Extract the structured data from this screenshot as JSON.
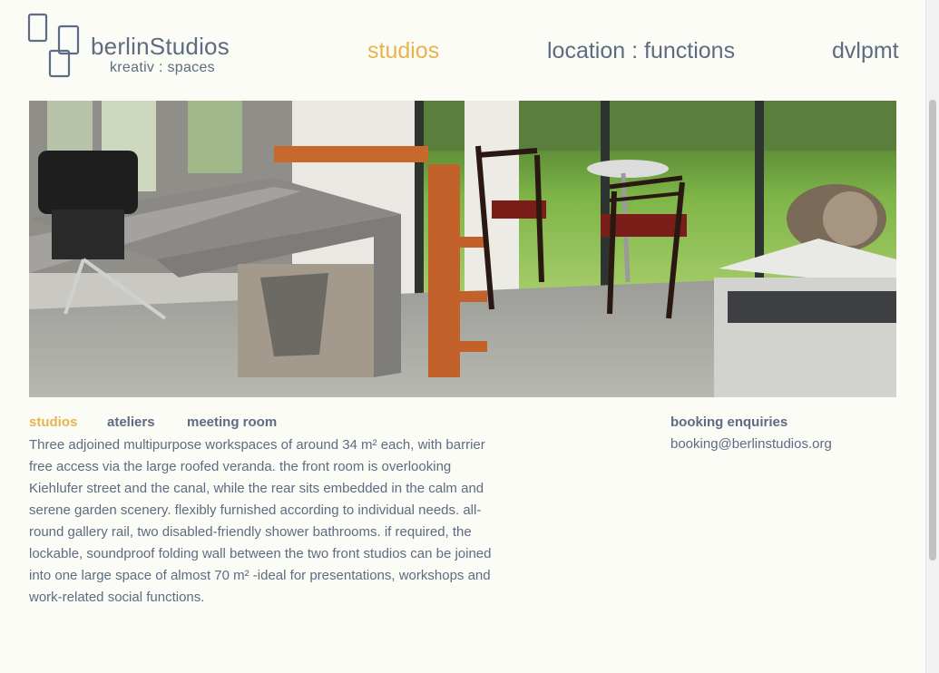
{
  "logo": {
    "title": "berlinStudios",
    "subtitle": "kreativ : spaces"
  },
  "nav": {
    "items": [
      {
        "label": "studios",
        "active": true
      },
      {
        "label": "location : functions",
        "active": false
      },
      {
        "label": "dvlpmt",
        "active": false
      }
    ]
  },
  "hero": {
    "alt": "Studio interior with desks, chairs and garden view through glass doors"
  },
  "subnav": {
    "items": [
      {
        "label": "studios",
        "active": true
      },
      {
        "label": "ateliers",
        "active": false
      },
      {
        "label": "meeting room",
        "active": false
      }
    ]
  },
  "description": "Three adjoined multipurpose workspaces of around 34 m² each, with barrier free access via the large roofed veranda. the front room is overlooking Kiehlufer street and the canal, while the rear sits embedded in the calm and serene garden scenery. flexibly furnished according to individual needs. all-round gallery rail, two disabled-friendly shower bathrooms. if required, the lockable, soundproof folding wall between the two front studios can be joined into one large space of almost 70 m² -ideal for presentations, workshops and work-related social functions.",
  "booking": {
    "title": "booking enquiries",
    "email": "booking@berlinstudios.org"
  },
  "colors": {
    "accent": "#e7b44b",
    "text": "#5d6b83",
    "background": "#fcfcf6"
  }
}
